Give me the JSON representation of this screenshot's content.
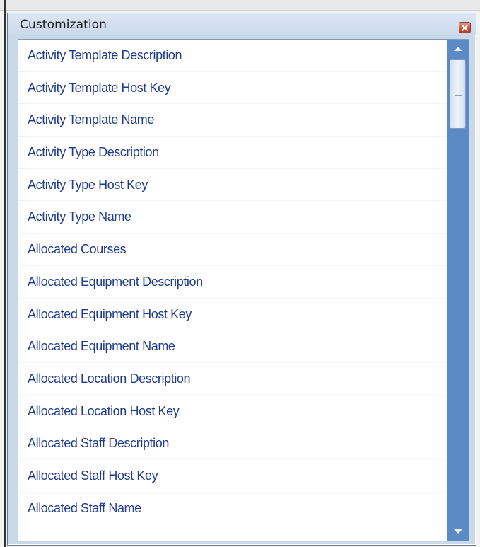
{
  "window": {
    "title": "Customization",
    "close_icon": "close-icon"
  },
  "list": {
    "items": [
      "Activity Template Description",
      "Activity Template Host Key",
      "Activity Template Name",
      "Activity Type Description",
      "Activity Type Host Key",
      "Activity Type Name",
      "Allocated Courses",
      "Allocated Equipment Description",
      "Allocated Equipment Host Key",
      "Allocated Equipment Name",
      "Allocated Location Description",
      "Allocated Location Host Key",
      "Allocated Staff Description",
      "Allocated Staff Host Key",
      "Allocated Staff Name"
    ]
  },
  "scrollbar": {
    "up_icon": "arrow-up-icon",
    "down_icon": "arrow-down-icon",
    "grip_icon": "grip-icon"
  },
  "colors": {
    "item_text": "#1f3b8a",
    "scrollbar": "#5b8ac6",
    "titlebar": "#cbd9ec"
  }
}
